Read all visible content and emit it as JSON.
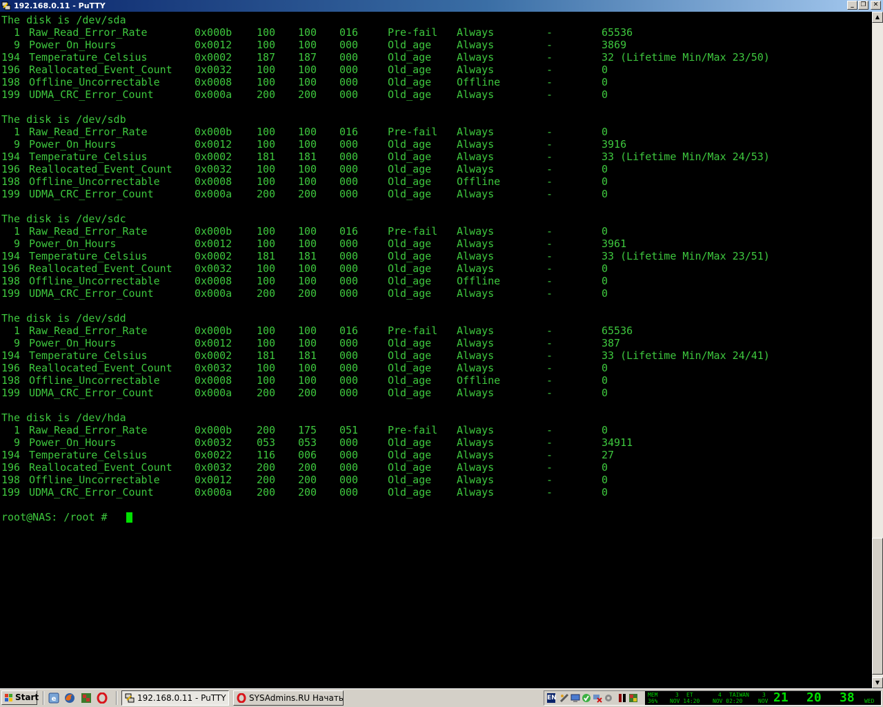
{
  "window": {
    "title": "192.168.0.11 - PuTTY"
  },
  "terminal": {
    "lines": [
      {
        "type": "text",
        "text": "The disk is /dev/sda"
      },
      {
        "type": "row",
        "cols": [
          "  1",
          "Raw_Read_Error_Rate",
          "0x000b",
          "100",
          "100",
          "016",
          "Pre-fail",
          "Always",
          "-",
          "65536"
        ]
      },
      {
        "type": "row",
        "cols": [
          "  9",
          "Power_On_Hours",
          "0x0012",
          "100",
          "100",
          "000",
          "Old_age",
          "Always",
          "-",
          "3869"
        ]
      },
      {
        "type": "row",
        "cols": [
          "194",
          "Temperature_Celsius",
          "0x0002",
          "187",
          "187",
          "000",
          "Old_age",
          "Always",
          "-",
          "32 (Lifetime Min/Max 23/50)"
        ]
      },
      {
        "type": "row",
        "cols": [
          "196",
          "Reallocated_Event_Count",
          "0x0032",
          "100",
          "100",
          "000",
          "Old_age",
          "Always",
          "-",
          "0"
        ]
      },
      {
        "type": "row",
        "cols": [
          "198",
          "Offline_Uncorrectable",
          "0x0008",
          "100",
          "100",
          "000",
          "Old_age",
          "Offline",
          "-",
          "0"
        ]
      },
      {
        "type": "row",
        "cols": [
          "199",
          "UDMA_CRC_Error_Count",
          "0x000a",
          "200",
          "200",
          "000",
          "Old_age",
          "Always",
          "-",
          "0"
        ]
      },
      {
        "type": "blank"
      },
      {
        "type": "text",
        "text": "The disk is /dev/sdb"
      },
      {
        "type": "row",
        "cols": [
          "  1",
          "Raw_Read_Error_Rate",
          "0x000b",
          "100",
          "100",
          "016",
          "Pre-fail",
          "Always",
          "-",
          "0"
        ]
      },
      {
        "type": "row",
        "cols": [
          "  9",
          "Power_On_Hours",
          "0x0012",
          "100",
          "100",
          "000",
          "Old_age",
          "Always",
          "-",
          "3916"
        ]
      },
      {
        "type": "row",
        "cols": [
          "194",
          "Temperature_Celsius",
          "0x0002",
          "181",
          "181",
          "000",
          "Old_age",
          "Always",
          "-",
          "33 (Lifetime Min/Max 24/53)"
        ]
      },
      {
        "type": "row",
        "cols": [
          "196",
          "Reallocated_Event_Count",
          "0x0032",
          "100",
          "100",
          "000",
          "Old_age",
          "Always",
          "-",
          "0"
        ]
      },
      {
        "type": "row",
        "cols": [
          "198",
          "Offline_Uncorrectable",
          "0x0008",
          "100",
          "100",
          "000",
          "Old_age",
          "Offline",
          "-",
          "0"
        ]
      },
      {
        "type": "row",
        "cols": [
          "199",
          "UDMA_CRC_Error_Count",
          "0x000a",
          "200",
          "200",
          "000",
          "Old_age",
          "Always",
          "-",
          "0"
        ]
      },
      {
        "type": "blank"
      },
      {
        "type": "text",
        "text": "The disk is /dev/sdc"
      },
      {
        "type": "row",
        "cols": [
          "  1",
          "Raw_Read_Error_Rate",
          "0x000b",
          "100",
          "100",
          "016",
          "Pre-fail",
          "Always",
          "-",
          "0"
        ]
      },
      {
        "type": "row",
        "cols": [
          "  9",
          "Power_On_Hours",
          "0x0012",
          "100",
          "100",
          "000",
          "Old_age",
          "Always",
          "-",
          "3961"
        ]
      },
      {
        "type": "row",
        "cols": [
          "194",
          "Temperature_Celsius",
          "0x0002",
          "181",
          "181",
          "000",
          "Old_age",
          "Always",
          "-",
          "33 (Lifetime Min/Max 23/51)"
        ]
      },
      {
        "type": "row",
        "cols": [
          "196",
          "Reallocated_Event_Count",
          "0x0032",
          "100",
          "100",
          "000",
          "Old_age",
          "Always",
          "-",
          "0"
        ]
      },
      {
        "type": "row",
        "cols": [
          "198",
          "Offline_Uncorrectable",
          "0x0008",
          "100",
          "100",
          "000",
          "Old_age",
          "Offline",
          "-",
          "0"
        ]
      },
      {
        "type": "row",
        "cols": [
          "199",
          "UDMA_CRC_Error_Count",
          "0x000a",
          "200",
          "200",
          "000",
          "Old_age",
          "Always",
          "-",
          "0"
        ]
      },
      {
        "type": "blank"
      },
      {
        "type": "text",
        "text": "The disk is /dev/sdd"
      },
      {
        "type": "row",
        "cols": [
          "  1",
          "Raw_Read_Error_Rate",
          "0x000b",
          "100",
          "100",
          "016",
          "Pre-fail",
          "Always",
          "-",
          "65536"
        ]
      },
      {
        "type": "row",
        "cols": [
          "  9",
          "Power_On_Hours",
          "0x0012",
          "100",
          "100",
          "000",
          "Old_age",
          "Always",
          "-",
          "387"
        ]
      },
      {
        "type": "row",
        "cols": [
          "194",
          "Temperature_Celsius",
          "0x0002",
          "181",
          "181",
          "000",
          "Old_age",
          "Always",
          "-",
          "33 (Lifetime Min/Max 24/41)"
        ]
      },
      {
        "type": "row",
        "cols": [
          "196",
          "Reallocated_Event_Count",
          "0x0032",
          "100",
          "100",
          "000",
          "Old_age",
          "Always",
          "-",
          "0"
        ]
      },
      {
        "type": "row",
        "cols": [
          "198",
          "Offline_Uncorrectable",
          "0x0008",
          "100",
          "100",
          "000",
          "Old_age",
          "Offline",
          "-",
          "0"
        ]
      },
      {
        "type": "row",
        "cols": [
          "199",
          "UDMA_CRC_Error_Count",
          "0x000a",
          "200",
          "200",
          "000",
          "Old_age",
          "Always",
          "-",
          "0"
        ]
      },
      {
        "type": "blank"
      },
      {
        "type": "text",
        "text": "The disk is /dev/hda"
      },
      {
        "type": "row",
        "cols": [
          "  1",
          "Raw_Read_Error_Rate",
          "0x000b",
          "200",
          "175",
          "051",
          "Pre-fail",
          "Always",
          "-",
          "0"
        ]
      },
      {
        "type": "row",
        "cols": [
          "  9",
          "Power_On_Hours",
          "0x0032",
          "053",
          "053",
          "000",
          "Old_age",
          "Always",
          "-",
          "34911"
        ]
      },
      {
        "type": "row",
        "cols": [
          "194",
          "Temperature_Celsius",
          "0x0022",
          "116",
          "006",
          "000",
          "Old_age",
          "Always",
          "-",
          "27"
        ]
      },
      {
        "type": "row",
        "cols": [
          "196",
          "Reallocated_Event_Count",
          "0x0032",
          "200",
          "200",
          "000",
          "Old_age",
          "Always",
          "-",
          "0"
        ]
      },
      {
        "type": "row",
        "cols": [
          "198",
          "Offline_Uncorrectable",
          "0x0012",
          "200",
          "200",
          "000",
          "Old_age",
          "Always",
          "-",
          "0"
        ]
      },
      {
        "type": "row",
        "cols": [
          "199",
          "UDMA_CRC_Error_Count",
          "0x000a",
          "200",
          "200",
          "000",
          "Old_age",
          "Always",
          "-",
          "0"
        ]
      },
      {
        "type": "blank"
      },
      {
        "type": "prompt",
        "text": "root@NAS: /root # "
      }
    ]
  },
  "taskbar": {
    "start_label": "Start",
    "quick_launch": [
      "ie-icon",
      "firefox-icon",
      "app-icon",
      "opera-icon"
    ],
    "tasks": [
      {
        "label": "192.168.0.11 - PuTTY",
        "icon": "putty-icon",
        "active": true
      },
      {
        "label": "SYSAdmins.RU Начать н...",
        "icon": "opera-icon",
        "active": false
      }
    ],
    "tray": {
      "lang": "EN",
      "mem_label": "MEM",
      "mem_value": "36%",
      "tz1": {
        "day": "3",
        "name": "ET",
        "date": "NOV 14:20"
      },
      "tz2": {
        "day": "4",
        "name": "TAIWAN",
        "date": "NOV 02:20"
      },
      "date_day": "3",
      "date_month": "NOV",
      "clock_h": "21",
      "clock_m": "20",
      "clock_s": "38",
      "weekday": "WED"
    }
  },
  "colors": {
    "terminal_text": "#3ec83e",
    "terminal_bg": "#000000",
    "cursor": "#00e000",
    "titlebar_start": "#0a246a",
    "titlebar_end": "#a6caf0"
  }
}
